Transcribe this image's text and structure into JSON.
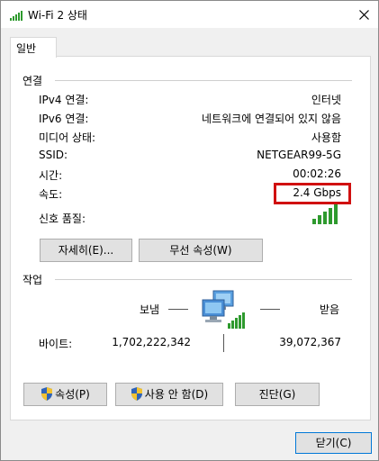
{
  "window": {
    "title": "Wi-Fi 2 상태"
  },
  "tabs": [
    {
      "label": "일반"
    }
  ],
  "connection": {
    "title": "연결",
    "rows": [
      {
        "label": "IPv4 연결:",
        "value": "인터넷"
      },
      {
        "label": "IPv6 연결:",
        "value": "네트워크에 연결되어 있지 않음"
      },
      {
        "label": "미디어 상태:",
        "value": "사용함"
      },
      {
        "label": "SSID:",
        "value": "NETGEAR99-5G"
      },
      {
        "label": "시간:",
        "value": "00:02:26"
      },
      {
        "label": "속도:",
        "value": "2.4 Gbps"
      }
    ],
    "signal_label": "신호 품질:",
    "signal_level": "5/5",
    "buttons": {
      "details": "자세히(E)...",
      "wireless_props": "무선 속성(W)"
    }
  },
  "activity": {
    "title": "작업",
    "sent_label": "보냄",
    "received_label": "받음",
    "bytes_label": "바이트:",
    "sent_bytes": "1,702,222,342",
    "received_bytes": "39,072,367"
  },
  "actions": {
    "properties": "속성(P)",
    "disable": "사용 안 함(D)",
    "diagnose": "진단(G)"
  },
  "footer": {
    "close": "닫기(C)"
  },
  "colors": {
    "highlight": "#d01010",
    "signal": "#2e9a2e",
    "accent": "#0078d7"
  },
  "icons": [
    "wifi-signal-icon",
    "close-icon",
    "network-computers-icon",
    "shield-icon"
  ]
}
